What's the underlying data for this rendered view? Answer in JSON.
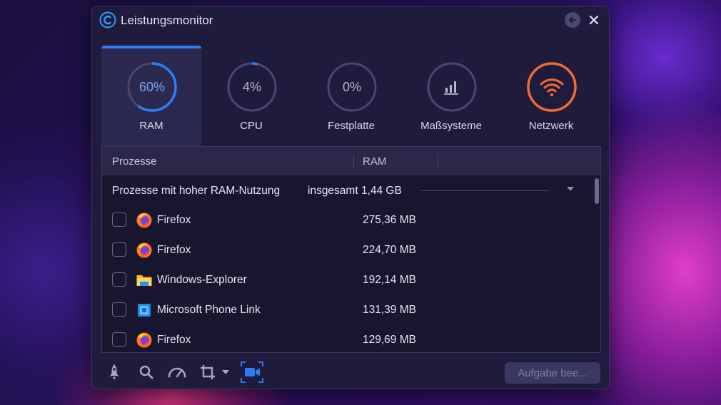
{
  "window": {
    "title": "Leistungsmonitor"
  },
  "tabs": [
    {
      "label": "RAM",
      "value": "60%",
      "percent": 60,
      "active": true,
      "color": "#2f7df0"
    },
    {
      "label": "CPU",
      "value": "4%",
      "percent": 4,
      "active": false,
      "color": "#2f7df0"
    },
    {
      "label": "Festplatte",
      "value": "0%",
      "percent": 0,
      "active": false,
      "color": "#2f7df0"
    },
    {
      "label": "Maßsysteme",
      "value": "",
      "active": false,
      "icon": "bar-chart-icon"
    },
    {
      "label": "Netzwerk",
      "value": "",
      "active": false,
      "icon": "wifi-icon",
      "color": "#f26a2e"
    }
  ],
  "table": {
    "columns": [
      "Prozesse",
      "RAM"
    ],
    "group": {
      "title": "Prozesse mit hoher RAM-Nutzung",
      "total": "insgesamt 1,44 GB"
    },
    "rows": [
      {
        "name": "Firefox",
        "ram": "275,36 MB",
        "icon": "firefox-icon"
      },
      {
        "name": "Firefox",
        "ram": "224,70 MB",
        "icon": "firefox-icon"
      },
      {
        "name": "Windows-Explorer",
        "ram": "192,14 MB",
        "icon": "folder-icon"
      },
      {
        "name": "Microsoft Phone Link",
        "ram": "131,39 MB",
        "icon": "phone-link-icon"
      },
      {
        "name": "Firefox",
        "ram": "129,69 MB",
        "icon": "firefox-icon"
      }
    ]
  },
  "footer": {
    "tools": [
      "rocket-icon",
      "search-icon",
      "speedometer-icon",
      "crop-icon",
      "screen-record-icon"
    ],
    "task_button": "Aufgabe bee..."
  },
  "colors": {
    "accent": "#2f7df0",
    "network": "#f26a2e",
    "window_bg": "#1f1b3d"
  }
}
